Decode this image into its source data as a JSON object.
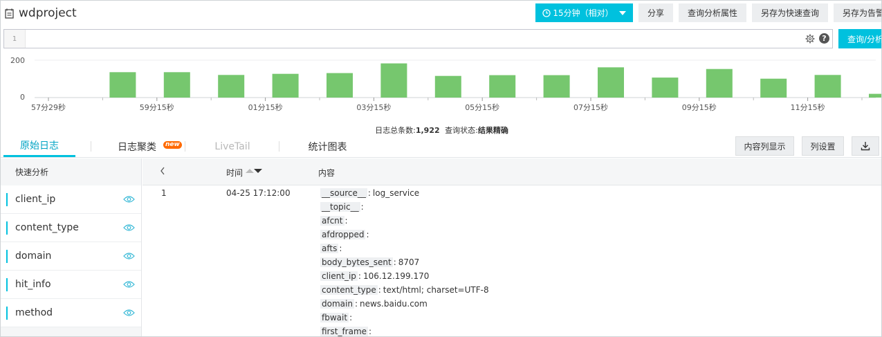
{
  "header": {
    "project_title": "wdproject",
    "time_range_label": "15分钟（相对）",
    "buttons": [
      "分享",
      "查询分析属性",
      "另存为快速查询",
      "另存为告警"
    ]
  },
  "query": {
    "line_number": "1",
    "value": "",
    "help_glyph": "?",
    "submit_label": "查询/分析"
  },
  "histogram": {
    "y_ticks": [
      "200",
      "0"
    ],
    "x_ticks": [
      "57分29秒",
      "59分15秒",
      "01分15秒",
      "03分15秒",
      "05分15秒",
      "07分15秒",
      "09分15秒",
      "11分15秒"
    ],
    "values": [
      0,
      136,
      136,
      121,
      127,
      131,
      183,
      116,
      120,
      120,
      162,
      107,
      153,
      101,
      121,
      20
    ],
    "bar_color": "#76c76e"
  },
  "summary": {
    "count_label": "日志总条数:",
    "count_value": "1,922",
    "status_label": "查询状态:",
    "status_value": "结果精确"
  },
  "tabs": {
    "items": [
      {
        "label": "原始日志"
      },
      {
        "label": "日志聚类"
      },
      {
        "label": "LiveTail"
      },
      {
        "label": "统计图表"
      }
    ],
    "new_badge": "new",
    "content_display_label": "内容列显示",
    "column_settings_label": "列设置"
  },
  "sidebar": {
    "title": "快速分析",
    "fields": [
      "client_ip",
      "content_type",
      "domain",
      "hit_info",
      "method"
    ]
  },
  "table": {
    "time_header": "时间",
    "content_header": "内容",
    "rows": [
      {
        "index": "1",
        "time": "04-25 17:12:00",
        "fields": [
          {
            "key": "__source__",
            "value": "log_service"
          },
          {
            "key": "__topic__",
            "value": ""
          },
          {
            "key": "afcnt",
            "value": ""
          },
          {
            "key": "afdropped",
            "value": ""
          },
          {
            "key": "afts",
            "value": ""
          },
          {
            "key": "body_bytes_sent",
            "value": "8707"
          },
          {
            "key": "client_ip",
            "value": "106.12.199.170"
          },
          {
            "key": "content_type",
            "value": "text/html; charset=UTF-8"
          },
          {
            "key": "domain",
            "value": "news.baidu.com"
          },
          {
            "key": "fbwait",
            "value": ""
          },
          {
            "key": "first_frame",
            "value": ""
          }
        ]
      }
    ]
  },
  "colors": {
    "accent": "#00c1de",
    "badge": "#ff6a00"
  }
}
